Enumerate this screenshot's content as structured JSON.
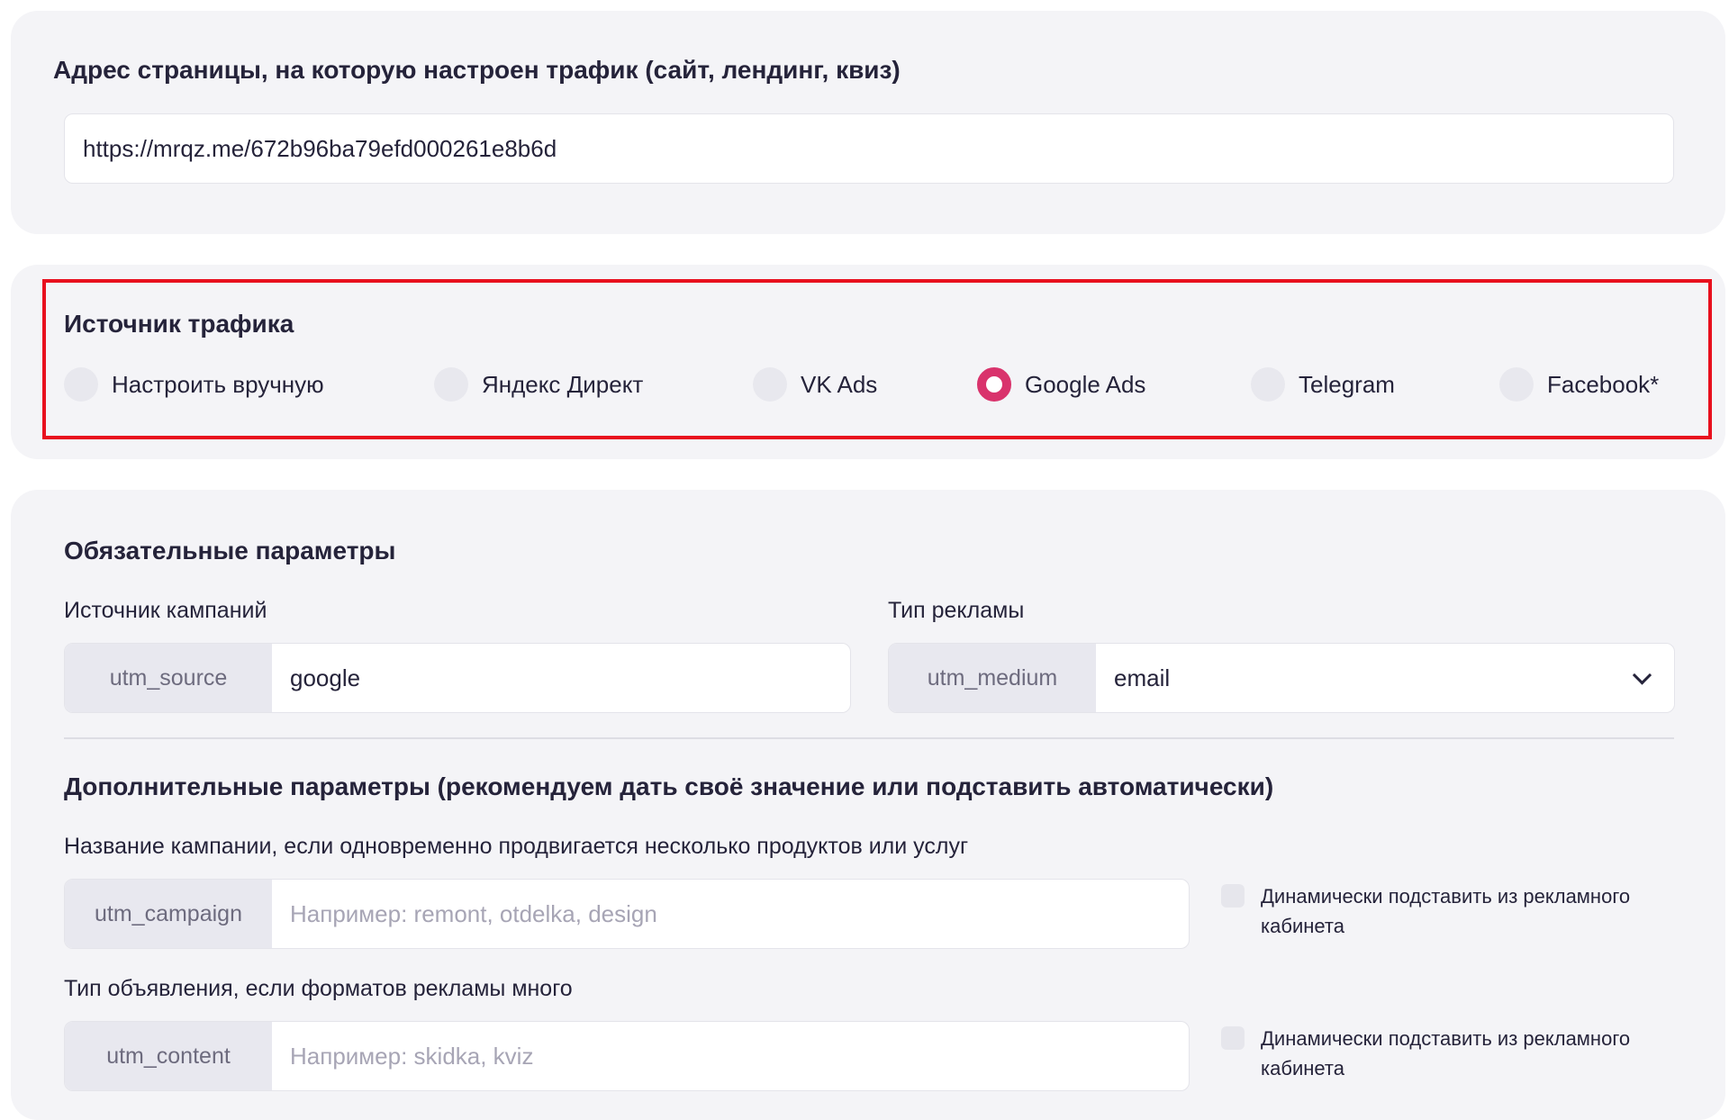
{
  "url_section": {
    "title": "Адрес страницы, на которую настроен трафик  (сайт, лендинг, квиз)",
    "url_value": "https://mrqz.me/672b96ba79efd000261e8b6d"
  },
  "source_section": {
    "title": "Источник трафика",
    "selected": "Google Ads",
    "options": [
      {
        "label": "Настроить вручную",
        "checked": false
      },
      {
        "label": "Яндекс Директ",
        "checked": false
      },
      {
        "label": "VK Ads",
        "checked": false
      },
      {
        "label": "Google Ads",
        "checked": true
      },
      {
        "label": "Telegram",
        "checked": false
      },
      {
        "label": "Facebook*",
        "checked": false
      }
    ]
  },
  "required_params": {
    "title": "Обязательные параметры",
    "source": {
      "label": "Источник кампаний",
      "prefix": "utm_source",
      "value": "google"
    },
    "medium": {
      "label": "Тип рекламы",
      "prefix": "utm_medium",
      "value": "email",
      "icon": "chevron-down-icon"
    }
  },
  "additional_params": {
    "title": "Дополнительные параметры (рекомендуем дать своё значение или подставить автоматически)",
    "campaign": {
      "label": "Название кампании, если одновременно продвигается несколько продуктов или услуг",
      "prefix": "utm_campaign",
      "placeholder": "Например: remont, otdelka, design",
      "dynamic_label": "Динамически подставить из рекламного кабинета",
      "dynamic_checked": false
    },
    "content": {
      "label": "Тип объявления, если форматов рекламы много",
      "prefix": "utm_content",
      "placeholder": "Например: skidka, kviz",
      "dynamic_label": "Динамически подставить из рекламного кабинета",
      "dynamic_checked": false
    }
  },
  "colors": {
    "accent": "#d9336c",
    "highlight_border": "#e8101e",
    "card_background": "#f4f4f7",
    "text": "#25233a"
  }
}
